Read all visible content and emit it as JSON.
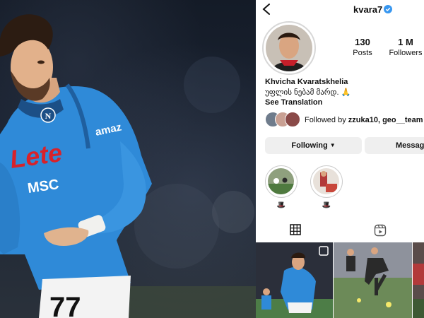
{
  "profile": {
    "username": "kvara7",
    "full_name": "Khvicha Kvaratskhelia",
    "bio": "უფლის ნებამ მარდ. 🙏",
    "see_translation": "See Translation",
    "verified_icon": "verified-badge-icon"
  },
  "stats": [
    {
      "value": "130",
      "label": "Posts"
    },
    {
      "value": "1 M",
      "label": "Followers"
    }
  ],
  "followed_by": {
    "prefix": "Followed by ",
    "users": "zzuka10, geo__team"
  },
  "buttons": {
    "following": "Following",
    "message": "Message"
  },
  "highlights": [
    {
      "label": "🎩"
    },
    {
      "label": "🎩"
    }
  ],
  "tabs": [
    {
      "name": "posts-grid-tab",
      "icon": "grid-icon",
      "active": true
    },
    {
      "name": "reels-tab",
      "icon": "reels-icon",
      "active": false
    }
  ],
  "photo": {
    "jersey_sponsor": "Lete",
    "jersey_brand": "amaz",
    "jersey_partner": "MSC",
    "jersey_number": "77"
  },
  "colors": {
    "jersey_blue": "#2f8ad8",
    "verified_blue": "#3897f0",
    "button_gray": "#efefef",
    "sponsor_red": "#d8222a"
  }
}
